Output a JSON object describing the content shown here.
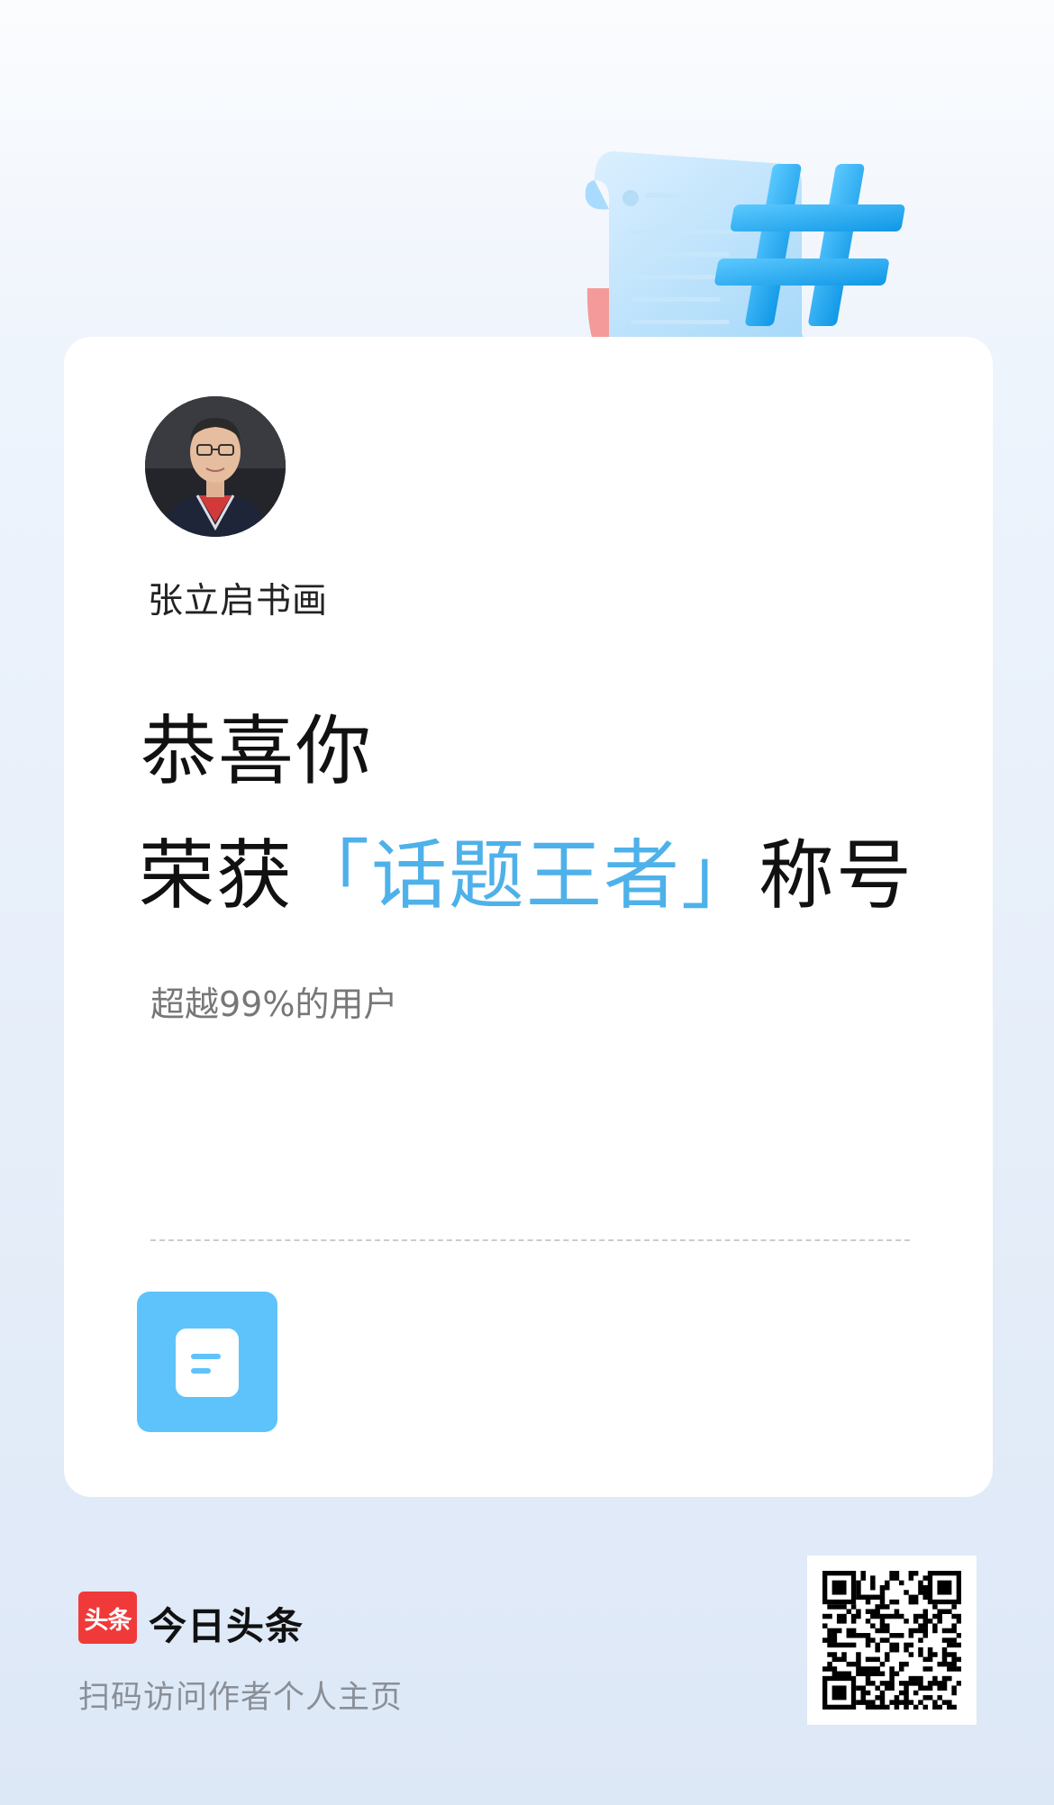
{
  "user": {
    "name": "张立启书画"
  },
  "achievement": {
    "line1": "恭喜你",
    "line2_prefix": "荣获",
    "title": "「话题王者」",
    "line2_suffix": "称号",
    "subtitle": "超越99%的用户"
  },
  "footer": {
    "logo_text": "头条",
    "brand_name": "今日头条",
    "caption": "扫码访问作者个人主页"
  },
  "colors": {
    "accent": "#4eb1ea",
    "badge": "#5ec3fb",
    "brand_red": "#f03a3a"
  },
  "icons": {
    "hero": "hashtag-scroll-illustration",
    "badge": "document-icon",
    "qr": "qr-code"
  }
}
